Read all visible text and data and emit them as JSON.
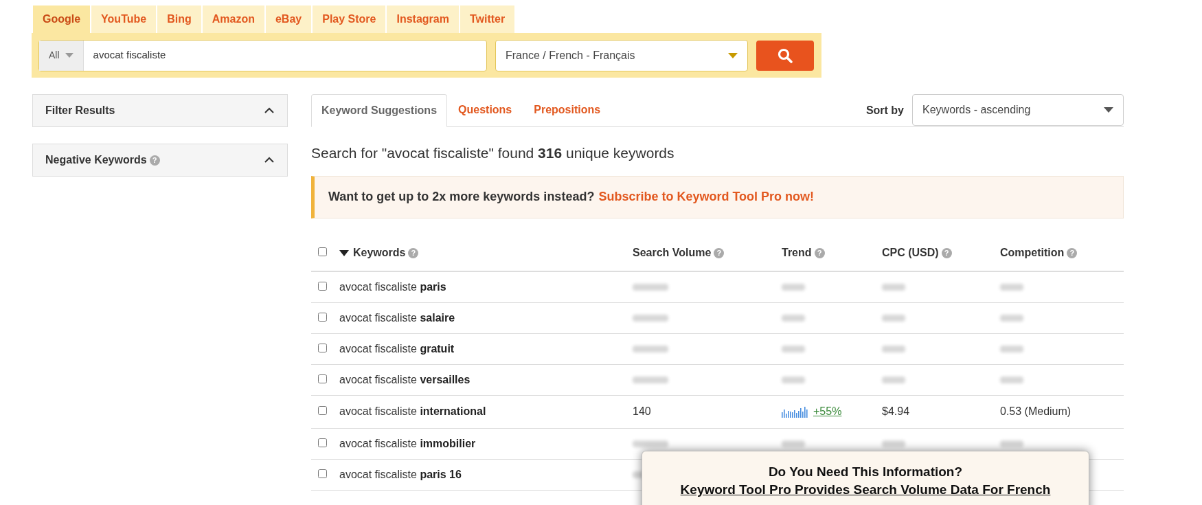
{
  "source_tabs": [
    {
      "label": "Google",
      "selected": true
    },
    {
      "label": "YouTube",
      "selected": false
    },
    {
      "label": "Bing",
      "selected": false
    },
    {
      "label": "Amazon",
      "selected": false
    },
    {
      "label": "eBay",
      "selected": false
    },
    {
      "label": "Play Store",
      "selected": false
    },
    {
      "label": "Instagram",
      "selected": false
    },
    {
      "label": "Twitter",
      "selected": false
    }
  ],
  "search": {
    "scope": "All",
    "value": "avocat fiscaliste",
    "location": "France / French - Français"
  },
  "sidebar": {
    "panels": [
      {
        "title": "Filter Results",
        "expanded": true
      },
      {
        "title": "Negative Keywords",
        "help": "?",
        "expanded": true
      }
    ]
  },
  "result_tabs": [
    {
      "label": "Keyword Suggestions",
      "selected": true
    },
    {
      "label": "Questions",
      "selected": false
    },
    {
      "label": "Prepositions",
      "selected": false
    }
  ],
  "sort": {
    "label": "Sort by",
    "value": "Keywords - ascending"
  },
  "summary": "Search for \"avocat fiscaliste\" found **316** unique keywords",
  "banner": {
    "text": "Want to get up to 2x more keywords instead?",
    "link": "Subscribe to Keyword Tool Pro now!"
  },
  "table": {
    "select_all_checked": false,
    "columns": [
      {
        "label": "Keywords",
        "help": "?",
        "sorted": true
      },
      {
        "label": "Search Volume",
        "help": "?",
        "sorted": false
      },
      {
        "label": "Trend",
        "help": "?",
        "sorted": false
      },
      {
        "label": "CPC (USD)",
        "help": "?",
        "sorted": false
      },
      {
        "label": "Competition",
        "help": "?",
        "sorted": false
      }
    ],
    "rows": [
      {
        "kind": "blurred",
        "keyword": "avocat fiscaliste **paris**",
        "checked": false
      },
      {
        "kind": "blurred",
        "keyword": "avocat fiscaliste **salaire**",
        "checked": false
      },
      {
        "kind": "blurred",
        "keyword": "avocat fiscaliste **gratuit**",
        "checked": false
      },
      {
        "kind": "blurred",
        "keyword": "avocat fiscaliste **versailles**",
        "checked": false
      },
      {
        "kind": "data",
        "keyword": "avocat fiscaliste **international**",
        "checked": false,
        "volume": "140",
        "trend": "+55%",
        "cpc": "$4.94",
        "competition": "0.53 (Medium)"
      },
      {
        "kind": "blurred",
        "keyword": "avocat fiscaliste **immobilier**",
        "checked": false
      },
      {
        "kind": "covered",
        "keyword": "avocat fiscaliste **paris 16**",
        "checked": false
      }
    ]
  },
  "popup": {
    "title": "Do You Need This Information?",
    "link": "Keyword Tool Pro Provides Search Volume Data For French"
  }
}
